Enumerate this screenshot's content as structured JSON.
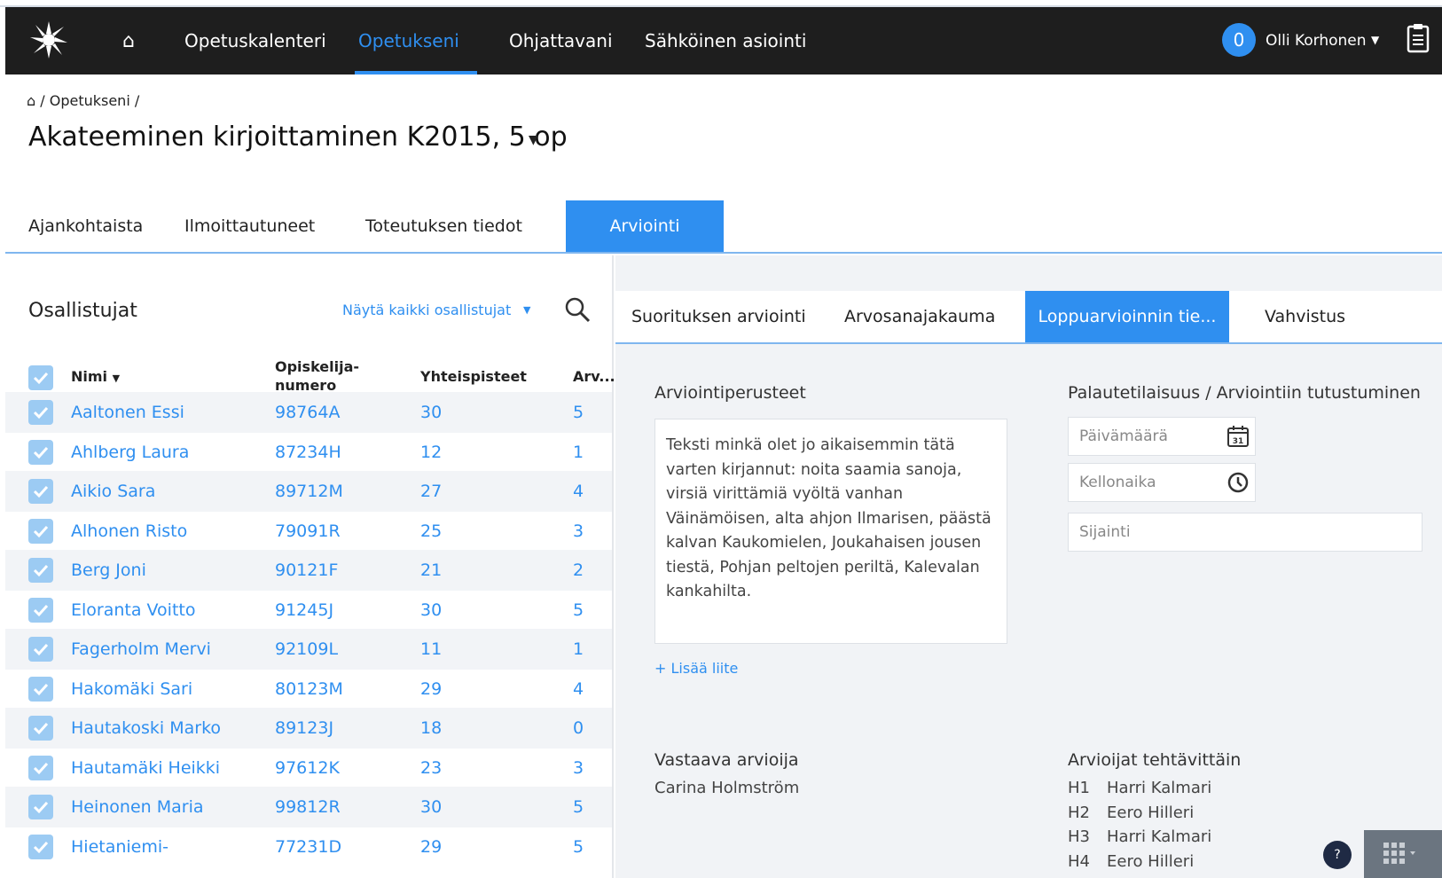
{
  "nav": {
    "items": [
      "Opetuskalenteri",
      "Opetukseni",
      "Ohjattavani",
      "Sähköinen asiointi"
    ],
    "active": "Opetukseni",
    "badge": "0",
    "user": "Olli Korhonen"
  },
  "breadcrumb": "/ Opetukseni /",
  "page_title": "Akateeminen kirjoittaminen K2015, 5 op",
  "tabs": [
    "Ajankohtaista",
    "Ilmoittautuneet",
    "Toteutuksen tiedot",
    "Arviointi"
  ],
  "participants": {
    "title": "Osallistujat",
    "show_all": "Näytä kaikki osallistujat",
    "columns": {
      "name": "Nimi",
      "student_number_1": "Opiskelija-",
      "student_number_2": "numero",
      "points": "Yhteispisteet",
      "grade": "Arv..."
    },
    "rows": [
      {
        "name": "Aaltonen Essi",
        "number": "98764A",
        "points": "30",
        "grade": "5"
      },
      {
        "name": "Ahlberg Laura",
        "number": "87234H",
        "points": "12",
        "grade": "1"
      },
      {
        "name": "Aikio Sara",
        "number": "89712M",
        "points": "27",
        "grade": "4"
      },
      {
        "name": "Alhonen Risto",
        "number": "79091R",
        "points": "25",
        "grade": "3"
      },
      {
        "name": "Berg Joni",
        "number": "90121F",
        "points": "21",
        "grade": "2"
      },
      {
        "name": "Eloranta Voitto",
        "number": "91245J",
        "points": "30",
        "grade": "5"
      },
      {
        "name": "Fagerholm Mervi",
        "number": "92109L",
        "points": "11",
        "grade": "1"
      },
      {
        "name": "Hakomäki Sari",
        "number": "80123M",
        "points": "29",
        "grade": "4"
      },
      {
        "name": "Hautakoski Marko",
        "number": "89123J",
        "points": "18",
        "grade": "0"
      },
      {
        "name": "Hautamäki Heikki",
        "number": "97612K",
        "points": "23",
        "grade": "3"
      },
      {
        "name": "Heinonen Maria",
        "number": "99812R",
        "points": "30",
        "grade": "5"
      },
      {
        "name": "Hietaniemi-",
        "number": "77231D",
        "points": "29",
        "grade": "5"
      }
    ]
  },
  "sub_tabs": [
    "Suorituksen arviointi",
    "Arvosanajakauma",
    "Loppuarvioinnin tie...",
    "Vahvistus"
  ],
  "criteria": {
    "label": "Arviointiperusteet",
    "text": "Teksti minkä olet jo aikaisemmin tätä varten kirjannut: noita saamia sanoja, virsiä virittämiä vyöltä vanhan Väinämöisen, alta ahjon Ilmarisen, päästä kalvan Kaukomielen, Joukahaisen jousen tiestä, Pohjan peltojen periltä, Kalevalan kankahilta.",
    "add_attachment": "+ Lisää liite"
  },
  "feedback": {
    "label": "Palautetilaisuus / Arviointiin tutustuminen",
    "date_placeholder": "Päivämäärä",
    "time_placeholder": "Kellonaika",
    "location_placeholder": "Sijainti",
    "calendar_day": "31"
  },
  "responsible": {
    "label": "Vastaava arvioija",
    "name": "Carina Holmström"
  },
  "assessors": {
    "label": "Arvioijat tehtävittäin",
    "items": [
      {
        "task": "H1",
        "name": "Harri Kalmari"
      },
      {
        "task": "H2",
        "name": "Eero Hilleri"
      },
      {
        "task": "H3",
        "name": "Harri Kalmari"
      },
      {
        "task": "H4",
        "name": "Eero Hilleri"
      }
    ]
  },
  "help": "?",
  "colors": {
    "accent": "#2f8ff0",
    "topbar": "#1e1e1e",
    "panel": "#f1f3f6"
  }
}
